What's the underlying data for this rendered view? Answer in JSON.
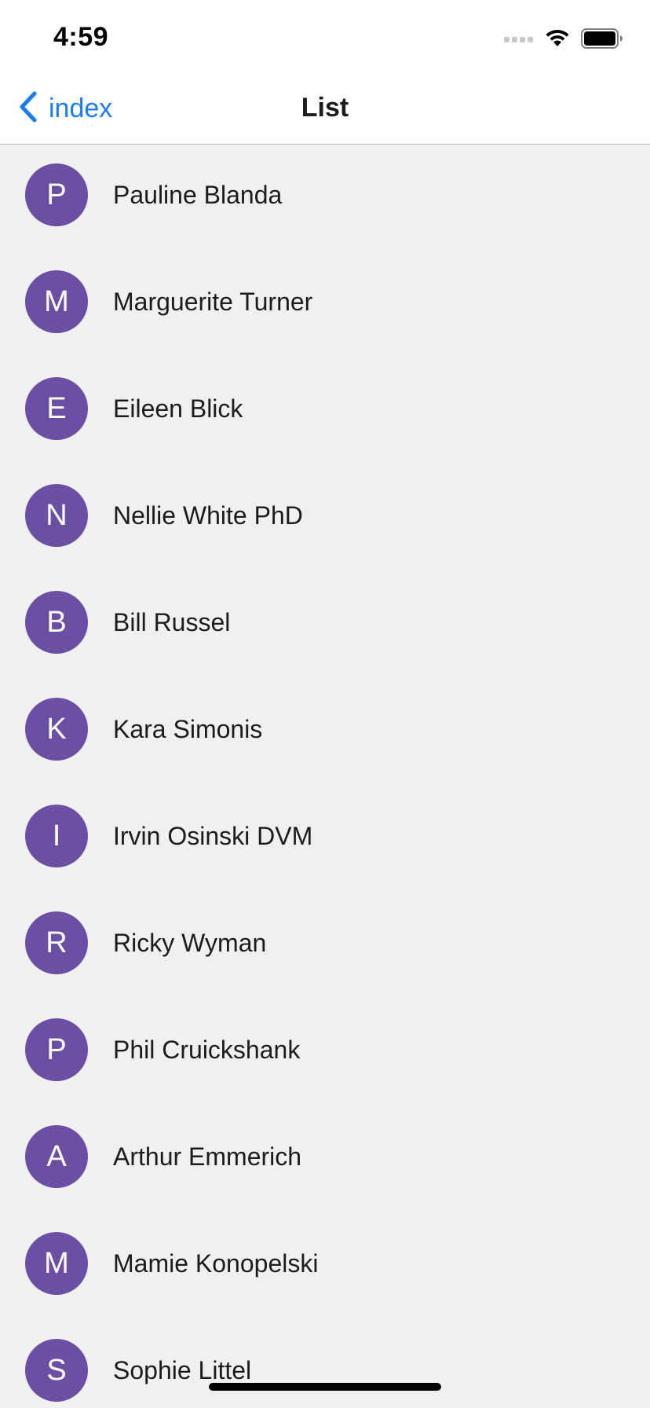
{
  "status_bar": {
    "time": "4:59",
    "icons": [
      "cellular-signal-icon",
      "wifi-icon",
      "battery-icon"
    ]
  },
  "nav": {
    "back_label": "index",
    "title": "List"
  },
  "colors": {
    "accent": "#1a7cf5",
    "avatar_bg": "#6a4fa5",
    "background": "#f0f0f1"
  },
  "list": {
    "items": [
      {
        "initial": "P",
        "name": "Pauline Blanda"
      },
      {
        "initial": "M",
        "name": "Marguerite Turner"
      },
      {
        "initial": "E",
        "name": "Eileen Blick"
      },
      {
        "initial": "N",
        "name": "Nellie White PhD"
      },
      {
        "initial": "B",
        "name": "Bill Russel"
      },
      {
        "initial": "K",
        "name": "Kara Simonis"
      },
      {
        "initial": "I",
        "name": "Irvin Osinski DVM"
      },
      {
        "initial": "R",
        "name": "Ricky Wyman"
      },
      {
        "initial": "P",
        "name": "Phil Cruickshank"
      },
      {
        "initial": "A",
        "name": "Arthur Emmerich"
      },
      {
        "initial": "M",
        "name": "Mamie Konopelski"
      },
      {
        "initial": "S",
        "name": "Sophie Littel"
      }
    ]
  }
}
